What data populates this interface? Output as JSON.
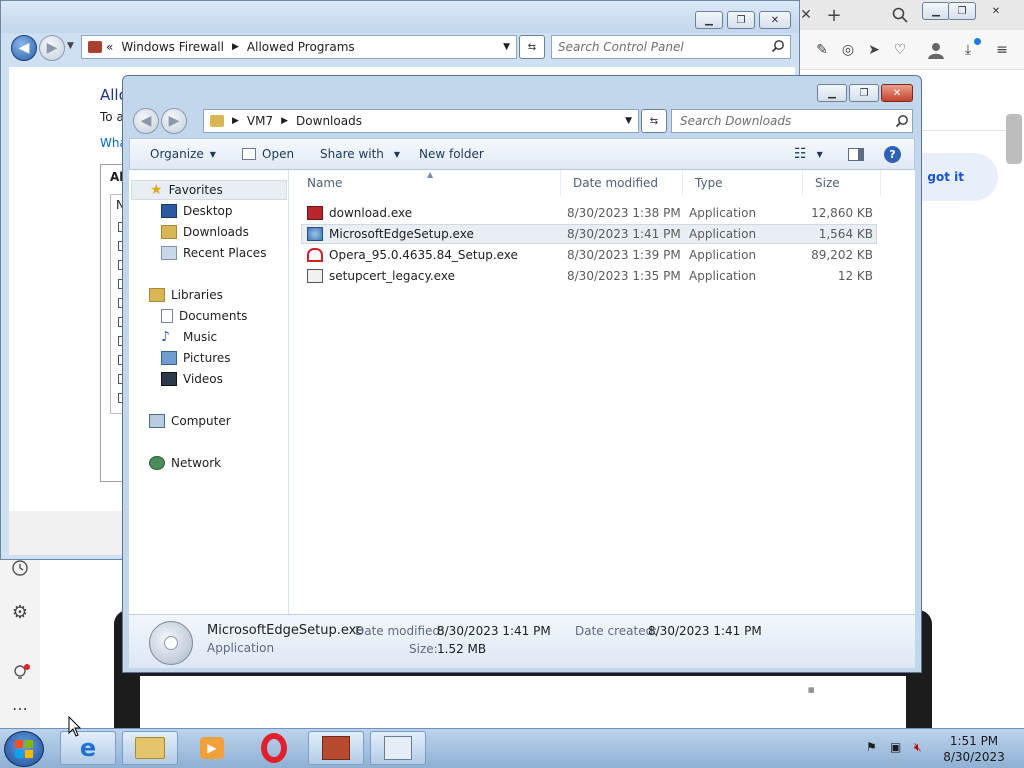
{
  "browser": {
    "new_tab_label": "+",
    "banner_text": "k, got it"
  },
  "firewall": {
    "address_prefix": "«",
    "crumbs": [
      "Windows Firewall",
      "Allowed Programs"
    ],
    "search_placeholder": "Search Control Panel",
    "heading": "Allo",
    "subtext": "To a",
    "link": "Wha",
    "group_label": "Al",
    "column_label": "N"
  },
  "explorer": {
    "crumbs": [
      "VM7",
      "Downloads"
    ],
    "search_placeholder": "Search Downloads",
    "toolbar": {
      "organize": "Organize",
      "open": "Open",
      "share_with": "Share with",
      "new_folder": "New folder"
    },
    "nav": {
      "favorites": "Favorites",
      "favorites_items": [
        "Desktop",
        "Downloads",
        "Recent Places"
      ],
      "libraries": "Libraries",
      "libraries_items": [
        "Documents",
        "Music",
        "Pictures",
        "Videos"
      ],
      "computer": "Computer",
      "network": "Network"
    },
    "columns": {
      "name": "Name",
      "date_modified": "Date modified",
      "type": "Type",
      "size": "Size"
    },
    "files": [
      {
        "name": "download.exe",
        "date": "8/30/2023 1:38 PM",
        "type": "Application",
        "size": "12,860 KB"
      },
      {
        "name": "MicrosoftEdgeSetup.exe",
        "date": "8/30/2023 1:41 PM",
        "type": "Application",
        "size": "1,564 KB"
      },
      {
        "name": "Opera_95.0.4635.84_Setup.exe",
        "date": "8/30/2023 1:39 PM",
        "type": "Application",
        "size": "89,202 KB"
      },
      {
        "name": "setupcert_legacy.exe",
        "date": "8/30/2023 1:35 PM",
        "type": "Application",
        "size": "12 KB"
      }
    ],
    "details": {
      "name": "MicrosoftEdgeSetup.exe",
      "type": "Application",
      "date_modified_label": "Date modified:",
      "date_modified": "8/30/2023 1:41 PM",
      "date_created_label": "Date created:",
      "date_created": "8/30/2023 1:41 PM",
      "size_label": "Size:",
      "size": "1.52 MB"
    }
  },
  "taskbar": {
    "time": "1:51 PM",
    "date": "8/30/2023"
  },
  "colors": {
    "selection": "#e9eef5",
    "link": "#0066cc",
    "heading": "#1e3287"
  }
}
